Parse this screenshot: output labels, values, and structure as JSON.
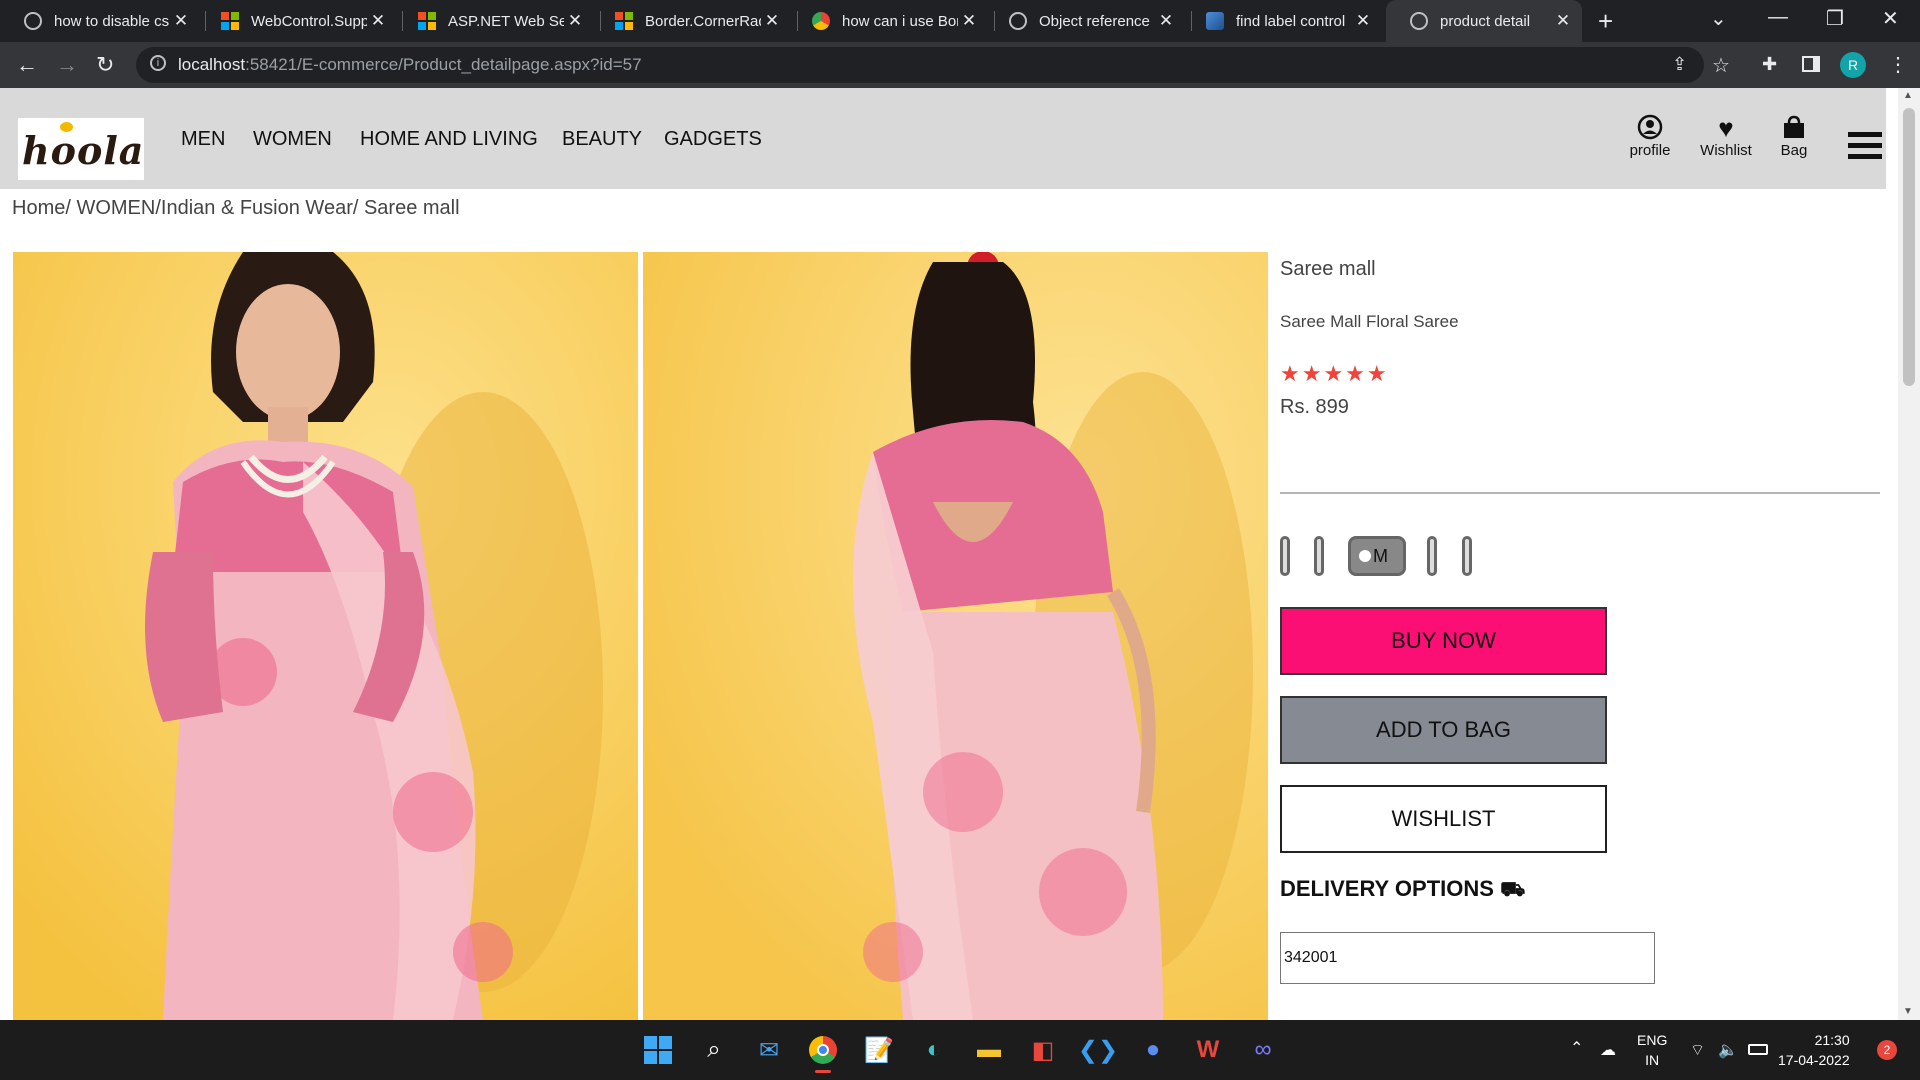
{
  "browser": {
    "tabs": [
      {
        "title": "how to disable cs",
        "icon": "globe-icon"
      },
      {
        "title": "WebControl.Supp",
        "icon": "microsoft-icon"
      },
      {
        "title": "ASP.NET Web Ser",
        "icon": "microsoft-icon"
      },
      {
        "title": "Border.CornerRad",
        "icon": "microsoft-icon"
      },
      {
        "title": "how can i use Bor",
        "icon": "chrome-icon"
      },
      {
        "title": "Object reference",
        "icon": "globe-icon"
      },
      {
        "title": "find label control",
        "icon": "stack-icon"
      },
      {
        "title": "product detail",
        "icon": "globe-icon"
      }
    ],
    "active_tab": 7,
    "url_host": "localhost",
    "url_rest": ":58421/E-commerce/Product_detailpage.aspx?id=57",
    "profile_initial": "R"
  },
  "site": {
    "logo": "hoola",
    "nav": [
      "MEN",
      "WOMEN",
      "HOME AND LIVING",
      "BEAUTY",
      "GADGETS"
    ],
    "icons": {
      "profile": "profile",
      "wishlist": "Wishlist",
      "bag": "Bag"
    }
  },
  "breadcrumb": "Home/ WOMEN/Indian & Fusion Wear/ Saree mall",
  "product": {
    "brand": "Saree mall",
    "name": "Saree Mall Floral Saree",
    "rating": 5,
    "stars": "★★★★★",
    "price": "Rs. 899",
    "selected_size": "M",
    "buy_now": "BUY NOW",
    "add_to_bag": "ADD TO BAG",
    "wishlist": "WISHLIST",
    "delivery_title": "DELIVERY OPTIONS",
    "pincode": "342001"
  },
  "taskbar": {
    "lang1": "ENG",
    "lang2": "IN",
    "time": "21:30",
    "date": "17-04-2022",
    "notifications": "2"
  }
}
